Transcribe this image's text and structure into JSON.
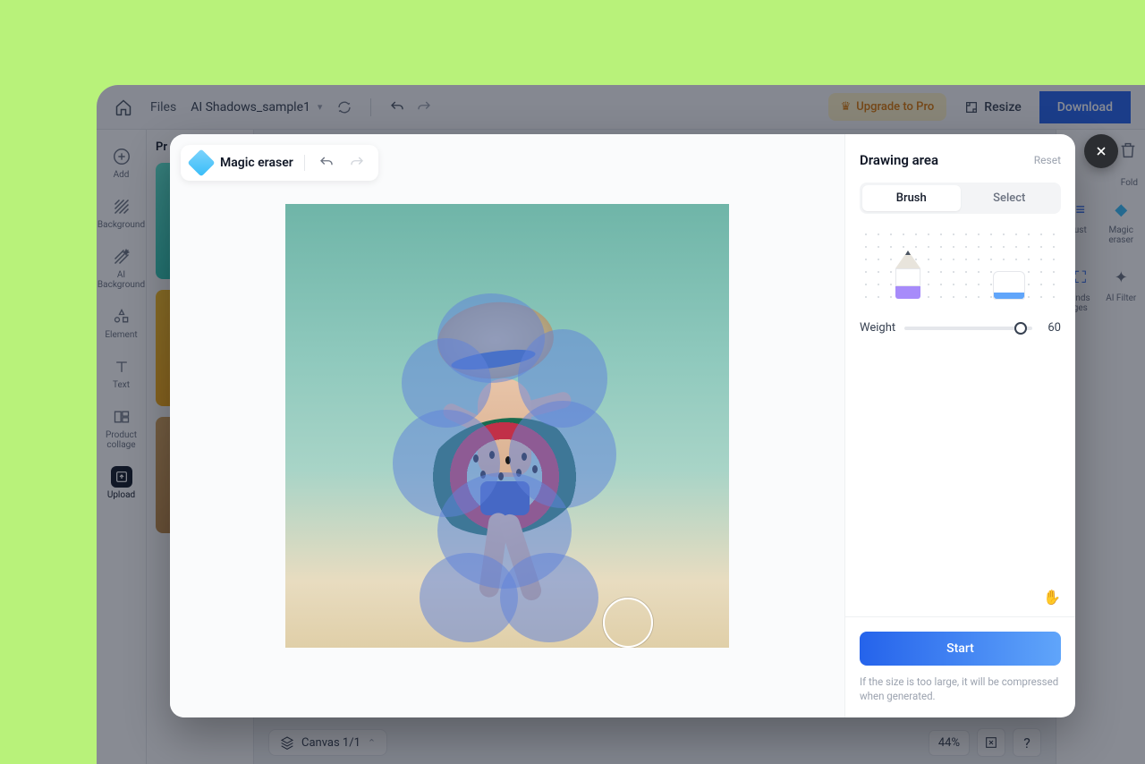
{
  "topbar": {
    "files_label": "Files",
    "file_name": "AI Shadows_sample1",
    "upgrade_label": "Upgrade to Pro",
    "resize_label": "Resize",
    "download_label": "Download"
  },
  "left_rail": [
    {
      "label": "Add"
    },
    {
      "label": "Background"
    },
    {
      "label": "AI Background"
    },
    {
      "label": "Element"
    },
    {
      "label": "Text"
    },
    {
      "label": "Product collage"
    },
    {
      "label": "Upload"
    }
  ],
  "left_panel": {
    "title": "Pr"
  },
  "canvas": {
    "canvas_label": "Canvas 1/1",
    "zoom": "44%"
  },
  "right_rail": {
    "folder_label": "Fold",
    "tools": [
      {
        "label": "ust"
      },
      {
        "label": "Magic eraser"
      },
      {
        "label": "ands ges"
      },
      {
        "label": "AI Filter"
      }
    ]
  },
  "modal": {
    "tool_title": "Magic eraser",
    "sidebar_title": "Drawing area",
    "reset_label": "Reset",
    "tab_brush": "Brush",
    "tab_select": "Select",
    "weight_label": "Weight",
    "weight_value": "60",
    "start_label": "Start",
    "footer_note": "If the size is too large, it will be compressed when generated."
  }
}
